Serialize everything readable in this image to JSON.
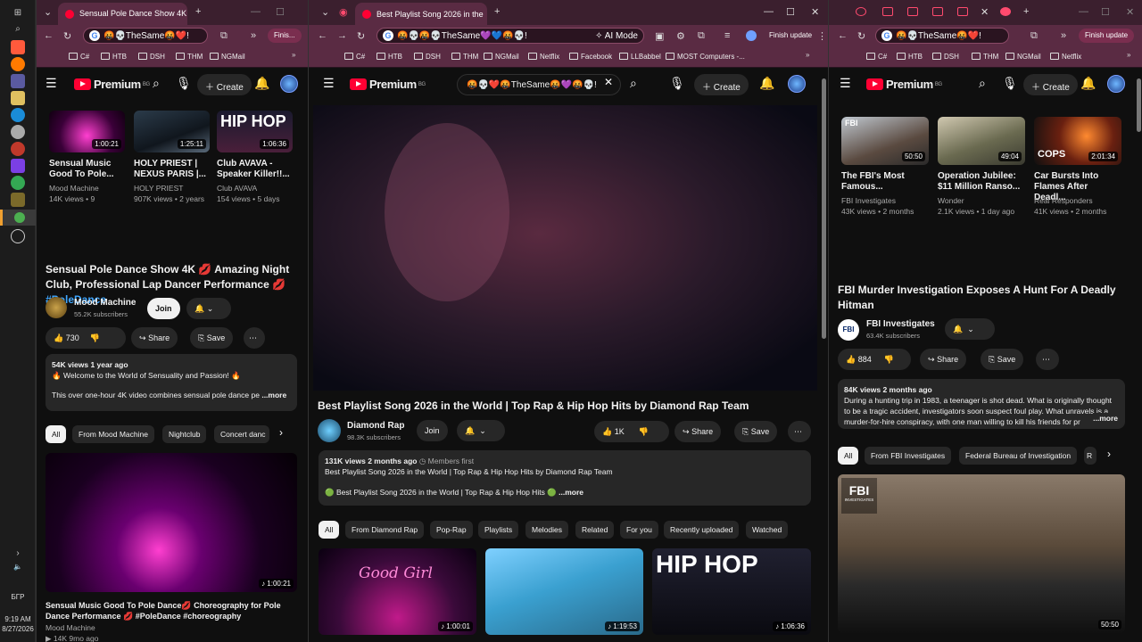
{
  "taskbar": {
    "lang": "БГР",
    "time": "9:19 AM",
    "date": "8/27/2026"
  },
  "left": {
    "tab_title": "Sensual Pole Dance Show 4K 💋",
    "omnibox": "🤬💀TheSame🤬❤️!",
    "finish": "Finis...",
    "bookmarks": [
      "C#",
      "HTB",
      "DSH",
      "THM",
      "NGMail"
    ],
    "logo": "Premium",
    "logo_badge": "BG",
    "create": "Create",
    "cards": [
      {
        "title": "Sensual Music Good To Pole...",
        "channel": "Mood Machine",
        "meta": "14K views • 9",
        "duration": "1:00:21"
      },
      {
        "title": "HOLY PRIEST | NEXUS PARIS |...",
        "channel": "HOLY PRIEST",
        "meta": "907K views • 2 years",
        "duration": "1:25:11"
      },
      {
        "title": "Club AVAVA - Speaker Killer!!...",
        "channel": "Club AVAVA",
        "meta": "154 views • 5 days",
        "duration": "1:06:36"
      }
    ],
    "video_title": "Sensual Pole Dance Show 4K 💋 Amazing Night Club, Professional Lap Dancer Performance 💋 ",
    "hashtag": "#PoleDance",
    "channel": "Mood Machine",
    "subs": "55.2K subscribers",
    "join": "Join",
    "likes": "730",
    "share": "Share",
    "save": "Save",
    "desc_stats": "54K views  1 year ago",
    "desc_line1": "🔥 Welcome to the World of Sensuality and Passion! 🔥",
    "desc_line2": "This over one-hour 4K video combines sensual pole dance pe",
    "more": "...more",
    "chips": [
      "All",
      "From Mood Machine",
      "Nightclub",
      "Concert danc"
    ],
    "rec_title": "Sensual Music Good To Pole Dance💋 Choreography for Pole Dance Performance 💋 #PoleDance #choreography",
    "rec_channel": "Mood Machine",
    "rec_meta": "▶ 14K   9mo ago",
    "rec_duration": "1:00:21"
  },
  "mid": {
    "tab_title": "Best Playlist Song 2026 in the",
    "omnibox": "🤬💀🤬💀TheSame💜💙🤬💀!",
    "ai_mode": "AI Mode",
    "finish": "Finish update",
    "bookmarks": [
      "C#",
      "HTB",
      "DSH",
      "THM",
      "NGMail",
      "Netflix",
      "Facebook",
      "LLBabbel",
      "MOST Computers -..."
    ],
    "logo": "Premium",
    "logo_badge": "BG",
    "search_query": "🤬💀❤️🤬TheSame🤬💜🤬💀!",
    "create": "Create",
    "video_title": "Best Playlist Song 2026 in the World | Top Rap & Hip Hop Hits by Diamond Rap Team",
    "channel": "Diamond Rap",
    "subs": "98.3K subscribers",
    "join": "Join",
    "likes": "1K",
    "share": "Share",
    "save": "Save",
    "desc_stats": "131K views  2 months ago",
    "members": "Members first",
    "desc_line1": "Best Playlist Song 2026 in the World | Top Rap & Hip Hop Hits by Diamond Rap Team",
    "desc_line2": "🟢 Best Playlist Song 2026 in the World | Top Rap & Hip Hop Hits 🟢",
    "more": "...more",
    "chips": [
      "All",
      "From Diamond Rap",
      "Pop-Rap",
      "Playlists",
      "Melodies",
      "Related",
      "For you",
      "Recently uploaded",
      "Watched"
    ],
    "recs": [
      {
        "label": "Good Girl",
        "duration": "1:00:01"
      },
      {
        "label": "",
        "duration": "1:19:53"
      },
      {
        "label": "HIP HOP",
        "duration": "1:06:36"
      }
    ]
  },
  "right": {
    "omnibox": "🤬💀TheSame🤬❤️!",
    "finish": "Finish update",
    "bookmarks": [
      "C#",
      "HTB",
      "DSH",
      "THM",
      "NGMail",
      "Netflix"
    ],
    "logo": "Premium",
    "logo_badge": "BG",
    "create": "Create",
    "cards": [
      {
        "title": "The FBI's Most Famous...",
        "channel": "FBI Investigates",
        "meta": "43K views • 2 months",
        "duration": "50:50"
      },
      {
        "title": "Operation Jubilee: $11 Million Ranso...",
        "channel": "Wonder",
        "meta": "2.1K views • 1 day ago",
        "duration": "49:04"
      },
      {
        "title": "Car Bursts Into Flames After Deadl...",
        "channel": "Real Responders",
        "meta": "41K views • 2 months",
        "duration": "2:01:34"
      }
    ],
    "video_title": "FBI Murder Investigation Exposes A Hunt For A Deadly Hitman",
    "channel": "FBI Investigates",
    "subs": "63.4K subscribers",
    "likes": "884",
    "share": "Share",
    "save": "Save",
    "desc_stats": "84K views  2 months ago",
    "desc_text": "During a hunting trip in 1983, a teenager is shot dead. What is originally thought to be a tragic accident, investigators soon suspect foul play. What unravels is a murder-for-hire conspiracy, with one man willing to kill his friends for pr",
    "more": "...more",
    "chips": [
      "All",
      "From FBI Investigates",
      "Federal Bureau of Investigation",
      "R"
    ],
    "rec_badge": "FBI",
    "rec_badge_sub": "INVESTIGATES",
    "rec_duration": "50:50"
  }
}
